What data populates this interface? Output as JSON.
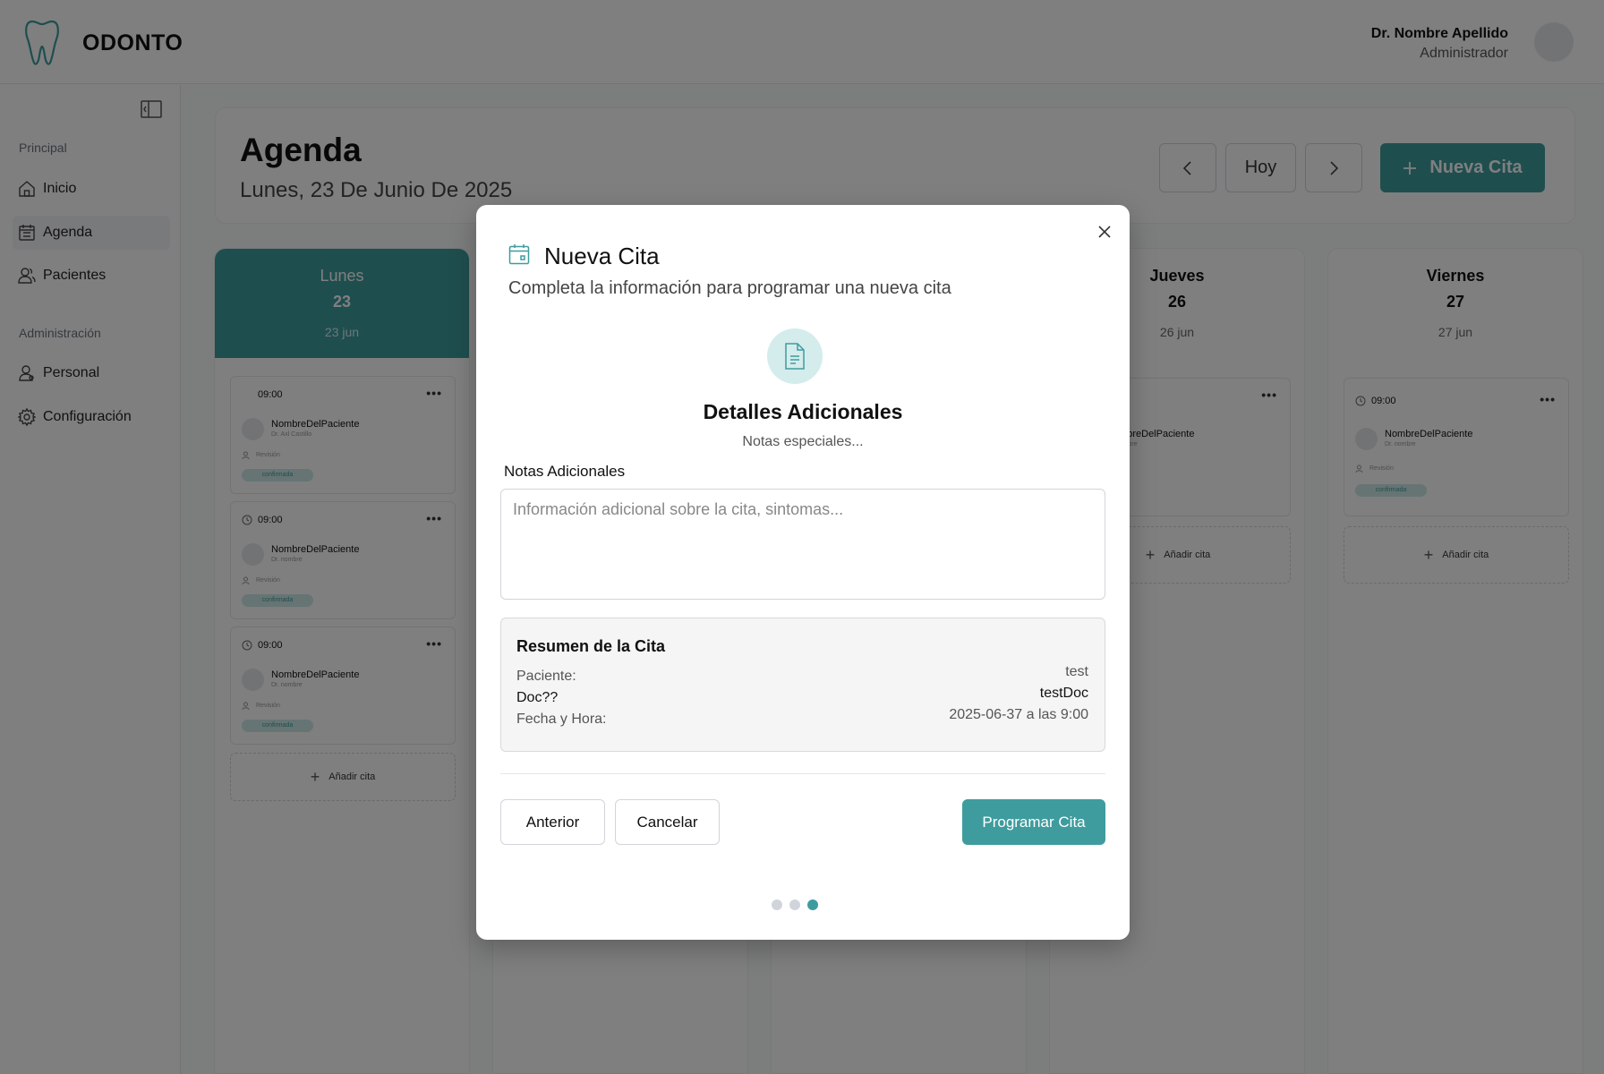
{
  "app": {
    "name": "ODONTO"
  },
  "user": {
    "name": "Dr. Nombre Apellido",
    "role": "Administrador"
  },
  "sidebar": {
    "sections": [
      {
        "label": "Principal",
        "items": [
          {
            "label": "Inicio",
            "icon": "home-icon"
          },
          {
            "label": "Agenda",
            "icon": "calendar-icon",
            "active": true
          },
          {
            "label": "Pacientes",
            "icon": "users-icon"
          }
        ]
      },
      {
        "label": "Administración",
        "items": [
          {
            "label": "Personal",
            "icon": "staff-icon"
          },
          {
            "label": "Configuración",
            "icon": "gear-icon"
          }
        ]
      }
    ]
  },
  "agenda": {
    "title": "Agenda",
    "date": "Lunes, 23 De Junio De 2025",
    "today_label": "Hoy",
    "new_label": "Nueva Cita",
    "days": [
      {
        "name": "Lunes",
        "num": "23",
        "short": "23 jun"
      },
      {
        "name": "Jueves",
        "num": "26",
        "short": "26 jun"
      },
      {
        "name": "Viernes",
        "num": "27",
        "short": "27 jun"
      }
    ],
    "appointments": [
      {
        "time": "09:00",
        "patient": "NombreDelPaciente",
        "doctor": "Dr. Axl Castillo",
        "type": "Revisión",
        "status": "confirmada"
      },
      {
        "time": "09:00",
        "patient": "NombreDelPaciente",
        "doctor": "Dr. nombre",
        "type": "Revisión",
        "status": "confirmada"
      },
      {
        "time": "09:00",
        "patient": "NombreDelPaciente",
        "doctor": "Dr. nombre",
        "type": "Revisión",
        "status": "confirmada"
      }
    ],
    "jueves_appt": {
      "patient": "NombreDelPaciente",
      "doctor": "Dr. nombre"
    },
    "viernes_appt": {
      "time": "09:00",
      "patient": "NombreDelPaciente",
      "doctor": "Dr. nombre",
      "type": "Revisión",
      "status": "confirmada"
    },
    "add_label": "Añadir cita"
  },
  "modal": {
    "title": "Nueva Cita",
    "subtitle": "Completa la información para programar una nueva cita",
    "step_title": "Detalles Adicionales",
    "step_subtitle": "Notas especiales...",
    "notes_label": "Notas Adicionales",
    "notes_value": "",
    "notes_placeholder": "Información adicional sobre la cita, sintomas...",
    "summary": {
      "title": "Resumen de la Cita",
      "patient_label": "Paciente:",
      "patient_value": "test",
      "doctor_label": "Doc??",
      "doctor_value": "testDoc",
      "datetime_label": "Fecha y Hora:",
      "datetime_value": "2025-06-37 a las 9:00"
    },
    "buttons": {
      "previous": "Anterior",
      "cancel": "Cancelar",
      "submit": "Programar Cita"
    },
    "steps_total": 3,
    "current_step": 3
  },
  "colors": {
    "accent": "#3f9c9e",
    "accent_light": "#d4ecec"
  }
}
